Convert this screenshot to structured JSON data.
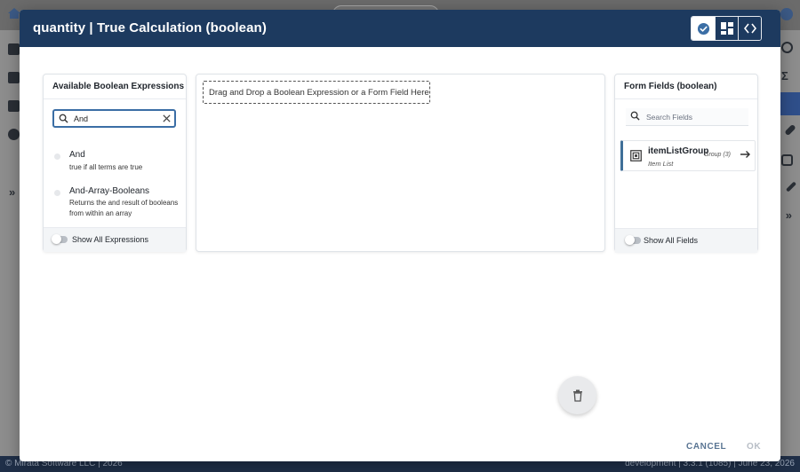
{
  "background": {
    "footer_left": "© Mirata Software LLC | 2026",
    "footer_right": "development | 3.3.1 (1085) | June 23, 2026"
  },
  "dialog": {
    "title": "quantity | True Calculation (boolean)",
    "header_buttons": [
      {
        "icon": "check-circle-icon",
        "active": true
      },
      {
        "icon": "dashboard-icon",
        "active": false
      },
      {
        "icon": "code-icon",
        "active": false
      }
    ],
    "colors": {
      "header": "#1d3a5f",
      "accent": "#3b6ea5",
      "cancel": "#5a7593"
    }
  },
  "left_panel": {
    "title": "Available Boolean Expressions",
    "search_value": "And",
    "expressions": [
      {
        "name": "And",
        "description": "true if all terms are true"
      },
      {
        "name": "And-Array-Booleans",
        "description": "Returns the and result of booleans from within an array"
      }
    ],
    "toggle_label": "Show All Expressions"
  },
  "canvas": {
    "drop_hint": "Drag and Drop a Boolean Expression or a Form Field Here"
  },
  "right_panel": {
    "title": "Form Fields (boolean)",
    "search_placeholder": "Search Fields",
    "fields": [
      {
        "name": "itemListGroup",
        "subtitle": "Item List",
        "type": "Group (3)"
      }
    ],
    "toggle_label": "Show All Fields"
  },
  "footer": {
    "cancel_label": "CANCEL",
    "ok_label": "OK"
  }
}
